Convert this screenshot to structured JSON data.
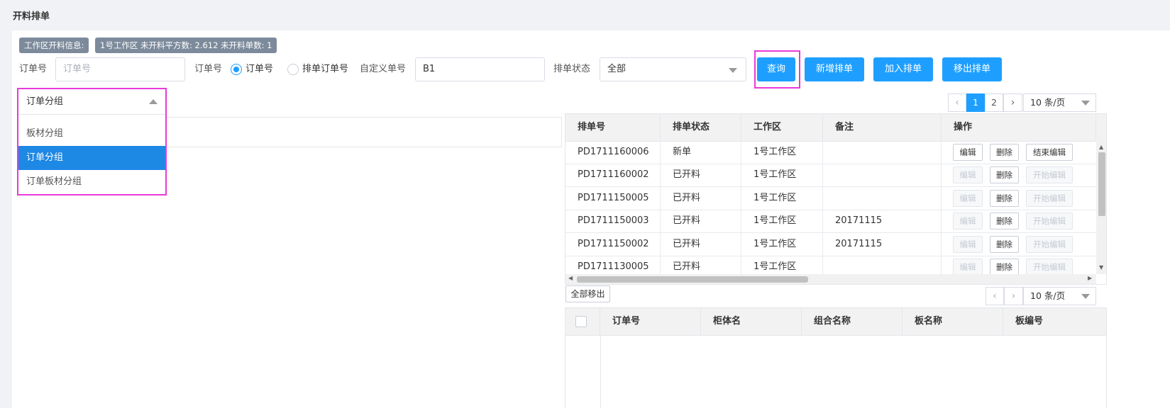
{
  "page": {
    "title": "开料排单"
  },
  "info": {
    "label": "工作区开料信息:",
    "summary": "1号工作区 未开料平方数: 2.612 未开料单数: 1"
  },
  "filters": {
    "order_no_label": "订单号",
    "order_no_placeholder": "订单号",
    "order_type_label": "订单号",
    "radio_order": "订单号",
    "radio_schedule_order": "排单订单号",
    "custom_no_label": "自定义单号",
    "custom_no_value": "B1",
    "status_label": "排单状态",
    "status_value": "全部"
  },
  "actions": {
    "query": "查询",
    "new_schedule": "新增排单",
    "add_schedule": "加入排单",
    "remove_schedule": "移出排单"
  },
  "group_select": {
    "selected": "订单分组",
    "options": [
      "板材分组",
      "订单分组",
      "订单板材分组"
    ]
  },
  "schedule_pager": {
    "page1": "1",
    "page2": "2",
    "page_size": "10 条/页"
  },
  "schedule_table": {
    "headers": [
      "排单号",
      "排单状态",
      "工作区",
      "备注",
      "操作"
    ],
    "rows": [
      {
        "no": "PD1711160006",
        "status": "新单",
        "area": "1号工作区",
        "note": "",
        "edit": "编辑",
        "del": "删除",
        "toggle": "结束编辑"
      },
      {
        "no": "PD1711160002",
        "status": "已开料",
        "area": "1号工作区",
        "note": "",
        "edit": "编辑",
        "del": "删除",
        "toggle": "开始编辑"
      },
      {
        "no": "PD1711150005",
        "status": "已开料",
        "area": "1号工作区",
        "note": "",
        "edit": "编辑",
        "del": "删除",
        "toggle": "开始编辑"
      },
      {
        "no": "PD1711150003",
        "status": "已开料",
        "area": "1号工作区",
        "note": "20171115",
        "edit": "编辑",
        "del": "删除",
        "toggle": "开始编辑"
      },
      {
        "no": "PD1711150002",
        "status": "已开料",
        "area": "1号工作区",
        "note": "20171115",
        "edit": "编辑",
        "del": "删除",
        "toggle": "开始编辑"
      },
      {
        "no": "PD1711130005",
        "status": "已开料",
        "area": "1号工作区",
        "note": "",
        "edit": "编辑",
        "del": "删除",
        "toggle": "开始编辑"
      }
    ]
  },
  "detail": {
    "remove_all": "全部移出",
    "page_size": "10 条/页",
    "headers": [
      "订单号",
      "柜体名",
      "组合名称",
      "板名称",
      "板编号"
    ]
  }
}
